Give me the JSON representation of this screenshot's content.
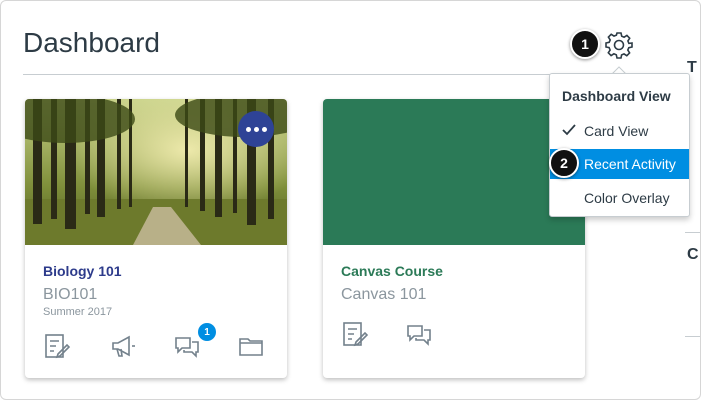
{
  "page": {
    "title": "Dashboard"
  },
  "callouts": [
    "1",
    "2"
  ],
  "right_edge_letters": [
    "T",
    "C"
  ],
  "menu": {
    "header": "Dashboard View",
    "items": [
      {
        "label": "Card View",
        "checked": true
      },
      {
        "label": "Recent Activity",
        "active": true
      },
      {
        "label": "Color Overlay"
      }
    ]
  },
  "cards": [
    {
      "name": "Biology 101",
      "code": "BIO101",
      "term": "Summer 2017",
      "color": "#2d3b8b",
      "hero": "forest-photo",
      "discussion_badge": "1",
      "icons": [
        "assignments-icon",
        "announcements-icon",
        "discussions-icon",
        "files-icon"
      ]
    },
    {
      "name": "Canvas Course",
      "code": "Canvas 101",
      "color": "#2b7a57",
      "hero": "solid-color",
      "icons": [
        "assignments-icon",
        "discussions-icon"
      ]
    }
  ],
  "colors": {
    "accent": "#008ee2",
    "card_more": "#2e4396",
    "text": "#2d3b45",
    "muted": "#8b969e"
  }
}
